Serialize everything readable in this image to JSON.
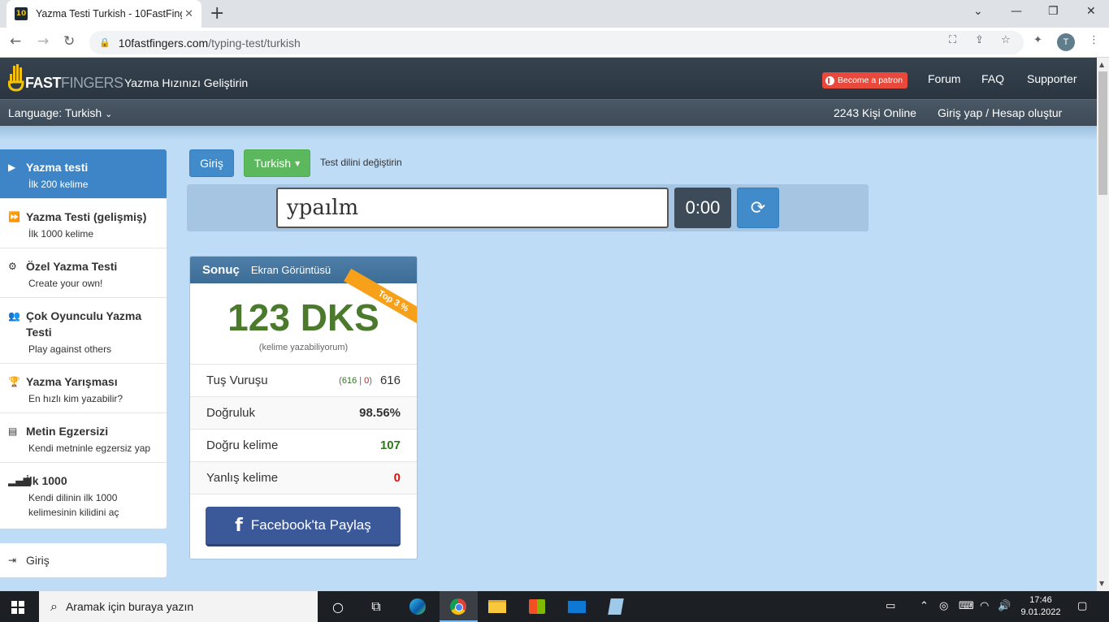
{
  "browser": {
    "tab_title": "Yazma Testi Turkish - 10FastFinge",
    "url_host": "10fastfingers.com",
    "url_path": "/typing-test/turkish",
    "profile_initial": "T"
  },
  "header": {
    "logo_fast": "FAST",
    "logo_fingers": "FINGERS",
    "tagline": "Yazma Hızınızı Geliştirin",
    "patron": "Become a patron",
    "nav": [
      "Forum",
      "FAQ",
      "Supporter"
    ]
  },
  "subheader": {
    "language": "Language: Turkish",
    "online": "2243 Kişi Online",
    "login": "Giriş yap / Hesap oluştur"
  },
  "sidebar": {
    "items": [
      {
        "title": "Yazma testi",
        "sub": "İlk 200 kelime",
        "icon": "play-icon"
      },
      {
        "title": "Yazma Testi (gelişmiş)",
        "sub": "İlk 1000 kelime",
        "icon": "fast-forward-icon"
      },
      {
        "title": "Özel Yazma Testi",
        "sub": "Create your own!",
        "icon": "cogs-icon"
      },
      {
        "title": "Çok Oyunculu Yazma Testi",
        "sub": "Play against others",
        "icon": "users-icon"
      },
      {
        "title": "Yazma Yarışması",
        "sub": "En hızlı kim yazabilir?",
        "icon": "trophy-icon"
      },
      {
        "title": "Metin Egzersizi",
        "sub": "Kendi metninle egzersiz yap",
        "icon": "document-icon"
      },
      {
        "title": "İlk 1000",
        "sub": "Kendi dilinin ilk 1000",
        "sub2": "kelimesinin kilidini aç",
        "icon": "signal-icon"
      }
    ],
    "login": "Giriş"
  },
  "controls": {
    "login_button": "Giriş",
    "language_button": "Turkish",
    "change_language": "Test dilini değiştirin",
    "input_value": "ypaılm",
    "timer": "0:00"
  },
  "result": {
    "title": "Sonuç",
    "screenshot": "Ekran Görüntüsü",
    "ribbon": "Top 3 %",
    "wpm": "123 DKS",
    "wpm_sub": "(kelime yazabiliyorum)",
    "keystrokes_label": "Tuş Vuruşu",
    "keystrokes_correct": "616",
    "keystrokes_sep": "|",
    "keystrokes_wrong": "0",
    "keystrokes_total": "616",
    "accuracy_label": "Doğruluk",
    "accuracy": "98.56%",
    "correct_label": "Doğru kelime",
    "correct": "107",
    "wrong_label": "Yanlış kelime",
    "wrong": "0",
    "facebook": "Facebook'ta Paylaş"
  },
  "taskbar": {
    "search_placeholder": "Aramak için buraya yazın",
    "time": "17:46",
    "date": "9.01.2022"
  },
  "colors": {
    "active_blue": "#3d85c6",
    "green_button": "#5cb85c",
    "wpm_green": "#4b7a2c",
    "ribbon_orange": "#f7a11a",
    "facebook_blue": "#3b5998"
  }
}
